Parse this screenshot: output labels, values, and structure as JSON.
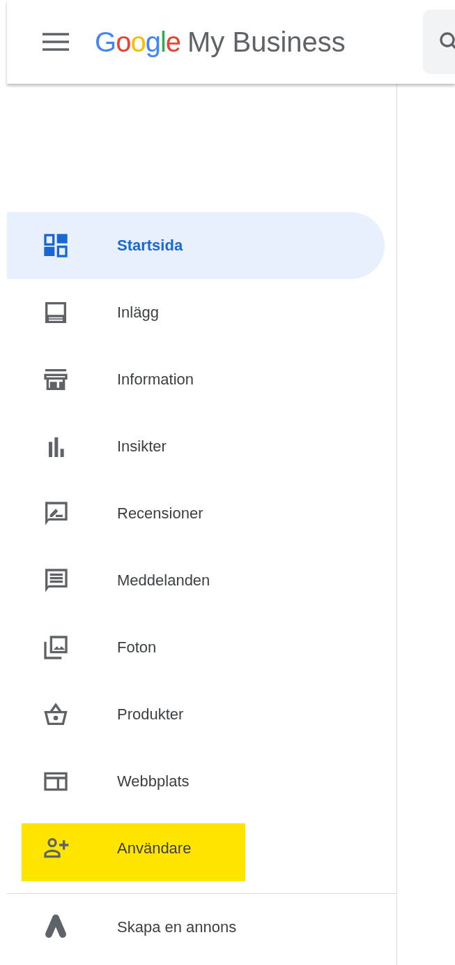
{
  "header": {
    "logo_brand": "Google",
    "logo_product": "My Business"
  },
  "nav": {
    "items": [
      {
        "label": "Startsida",
        "selected": true,
        "highlighted": false
      },
      {
        "label": "Inlägg",
        "selected": false,
        "highlighted": false
      },
      {
        "label": "Information",
        "selected": false,
        "highlighted": false
      },
      {
        "label": "Insikter",
        "selected": false,
        "highlighted": false
      },
      {
        "label": "Recensioner",
        "selected": false,
        "highlighted": false
      },
      {
        "label": "Meddelanden",
        "selected": false,
        "highlighted": false
      },
      {
        "label": "Foton",
        "selected": false,
        "highlighted": false
      },
      {
        "label": "Produkter",
        "selected": false,
        "highlighted": false
      },
      {
        "label": "Webbplats",
        "selected": false,
        "highlighted": false
      },
      {
        "label": "Användare",
        "selected": false,
        "highlighted": true
      }
    ]
  },
  "ads_link": {
    "label": "Skapa en annons"
  }
}
